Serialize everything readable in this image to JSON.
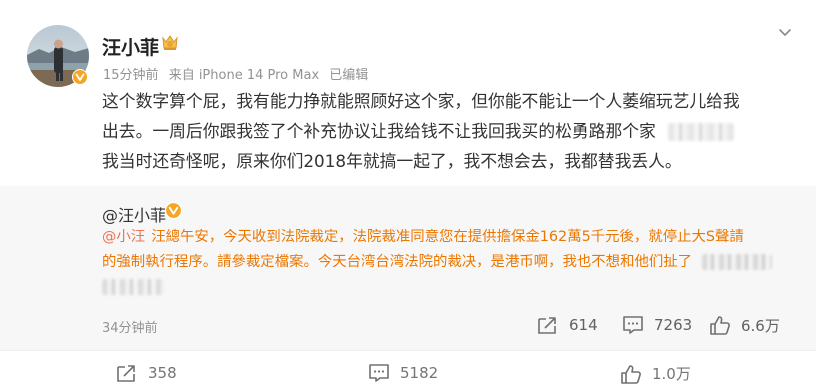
{
  "post": {
    "author": "汪小菲",
    "time": "15分钟前",
    "source": "来自 iPhone 14 Pro Max",
    "edited": "已编辑",
    "text_lines": [
      "这个数字算个屁，我有能力挣就能照顾好这个家，但你能不能让一个人萎缩玩艺儿给我",
      "出去。一周后你跟我签了个补充协议让我给钱不让我回我买的松勇路那个家",
      "我当时还奇怪呢，原来你们2018年就搞一起了，我不想会去，我都替我丢人。"
    ]
  },
  "repost": {
    "author": "@汪小菲",
    "mention": "@小汪",
    "text_lines": [
      "汪總午安，今天收到法院裁定，法院裁准同意您在提供擔保金162萬5千元後，就停止大S聲請",
      "的強制執行程序。請參裁定檔案。今天台湾台湾法院的裁决，是港币啊，我也不想和他们扯了"
    ],
    "time": "34分钟前",
    "shares": "614",
    "comments": "7263",
    "likes": "6.6万"
  },
  "bottom_bar": {
    "shares": "358",
    "comments": "5182",
    "likes": "1.0万"
  },
  "icons": [
    "avatar",
    "verified-badge-icon",
    "fan-medal-icon",
    "chevron-down-icon",
    "share-icon",
    "comment-icon",
    "like-icon"
  ],
  "colors": {
    "repost_bg": "#f7f7f7",
    "repost_text": "#ec7700",
    "mention": "#eb7350",
    "meta": "#939393",
    "badge": "#f5a623"
  }
}
